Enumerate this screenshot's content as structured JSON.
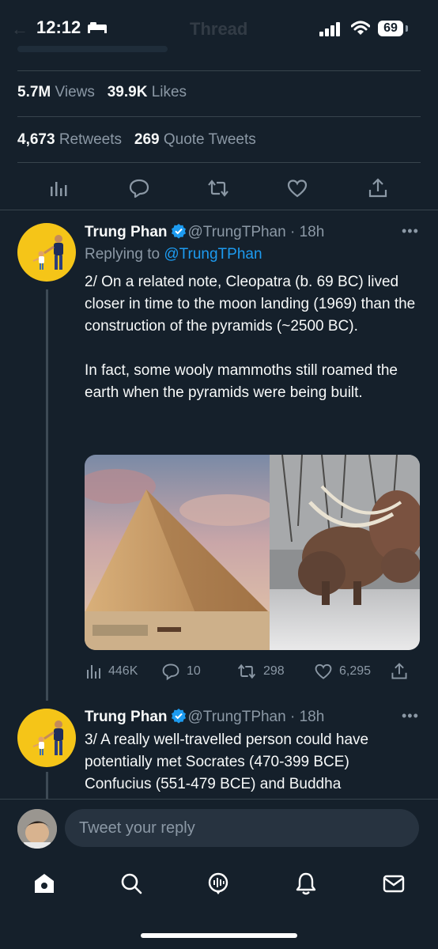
{
  "status_bar": {
    "time": "12:12",
    "battery": "69"
  },
  "header": {
    "title": "Thread"
  },
  "stats": {
    "views_count": "5.7M",
    "views_label": "Views",
    "likes_count": "39.9K",
    "likes_label": "Likes",
    "retweets_count": "4,673",
    "retweets_label": "Retweets",
    "quotes_count": "269",
    "quotes_label": "Quote Tweets"
  },
  "tweets": [
    {
      "name": "Trung Phan",
      "handle": "@TrungTPhan",
      "time": "18h",
      "replying_prefix": "Replying to",
      "replying_handle": "@TrungTPhan",
      "text": "2/ On a related note, Cleopatra (b. 69 BC) lived closer in time to the moon landing (1969) than the construction of the pyramids (~2500 BC).\n\nIn fact, some wooly mammoths still roamed the earth when the pyramids were being built.",
      "views": "446K",
      "replies": "10",
      "retweets": "298",
      "likes": "6,295"
    },
    {
      "name": "Trung Phan",
      "handle": "@TrungTPhan",
      "time": "18h",
      "text": "3/ A really well-travelled person could have potentially met Socrates (470-399 BCE) Confucius (551-479 BCE) and Buddha"
    }
  ],
  "reply_bar": {
    "placeholder": "Tweet your reply"
  },
  "tabs": [
    "home-icon",
    "search-icon",
    "spaces-icon",
    "notifications-icon",
    "messages-icon"
  ],
  "colors": {
    "background": "#15202b",
    "accent": "#1d9bf0",
    "muted": "#8b98a5",
    "text": "#f7f9f9"
  }
}
